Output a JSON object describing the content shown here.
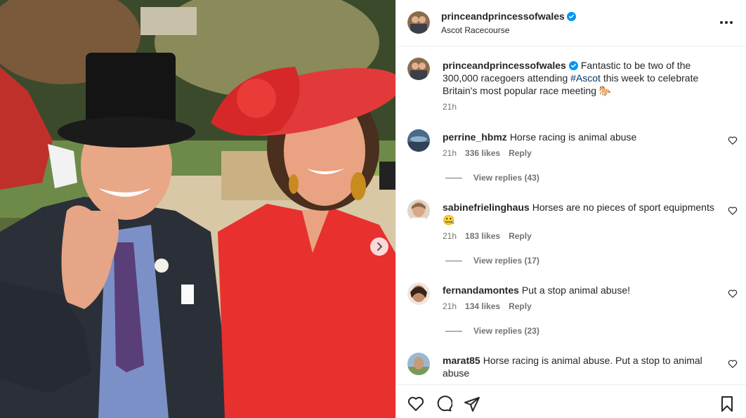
{
  "post": {
    "author": "princeandprincessofwales",
    "location": "Ascot Racecourse",
    "caption_before": "Fantastic to be two of the 300,000 racegoers attending ",
    "caption_hashtag": "#Ascot",
    "caption_after": " this week to celebrate Britain's most popular race meeting 🐎",
    "time": "21h"
  },
  "comments": [
    {
      "user": "perrine_hbmz",
      "text": "Horse racing is animal abuse",
      "time": "21h",
      "likes": "336 likes",
      "reply": "Reply",
      "view_replies": "View replies (43)"
    },
    {
      "user": "sabinefrielinghaus",
      "text": "Horses are no pieces of sport equipments 🤐",
      "time": "21h",
      "likes": "183 likes",
      "reply": "Reply",
      "view_replies": "View replies (17)"
    },
    {
      "user": "fernandamontes",
      "text": "Put a stop animal abuse!",
      "time": "21h",
      "likes": "134 likes",
      "reply": "Reply",
      "view_replies": "View replies (23)"
    },
    {
      "user": "marat85",
      "text": "Horse racing is animal abuse. Put a stop to animal abuse",
      "time": "",
      "likes": "",
      "reply": "",
      "view_replies": ""
    }
  ],
  "colors": {
    "verified": "#0095f6",
    "hat_red": "#e23a3a",
    "dress_red": "#e8302f"
  },
  "icons": {
    "like": "heart-icon",
    "comment": "comment-icon",
    "share": "send-icon",
    "save": "bookmark-icon",
    "menu": "more-icon",
    "next": "chevron-right-icon"
  }
}
